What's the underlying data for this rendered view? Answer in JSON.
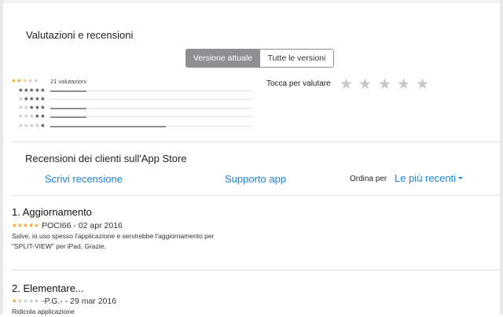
{
  "ratings": {
    "section_title": "Valutazioni e recensioni",
    "segments": [
      {
        "label": "Versione attuale",
        "selected": true
      },
      {
        "label": "Tutte le versioni",
        "selected": false
      }
    ],
    "average_rating": 2.5,
    "count_label": "21 valutazioni",
    "histogram": [
      {
        "stars": 5,
        "fraction": 0.18
      },
      {
        "stars": 4,
        "fraction": 0.0
      },
      {
        "stars": 3,
        "fraction": 0.18
      },
      {
        "stars": 2,
        "fraction": 0.18
      },
      {
        "stars": 1,
        "fraction": 0.57
      }
    ],
    "tap_to_rate_label": "Tocca per valutare"
  },
  "reviews_section": {
    "title": "Recensioni dei clienti sull'App Store",
    "write_review_label": "Scrivi recensione",
    "app_support_label": "Supporto app",
    "sort_label": "Ordina per",
    "sort_value": "Le più recenti"
  },
  "reviews": [
    {
      "title": "1. Aggiornamento",
      "rating": 5,
      "author_date": "POCI66 - 02 apr 2016",
      "body": "Salve, io uso spesso l'applicazione e servirebbe l'aggiornamento per \"SPLIT-VIEW\" per iPad, Grazie."
    },
    {
      "title": "2. Elementare...",
      "rating": 1,
      "author_date": "-P.G.- - 29 mar 2016",
      "body": "Ridicola applicazione"
    }
  ],
  "colors": {
    "accent": "#1a82e0",
    "star": "#f5a623",
    "segment_selected": "#8e8e93"
  }
}
